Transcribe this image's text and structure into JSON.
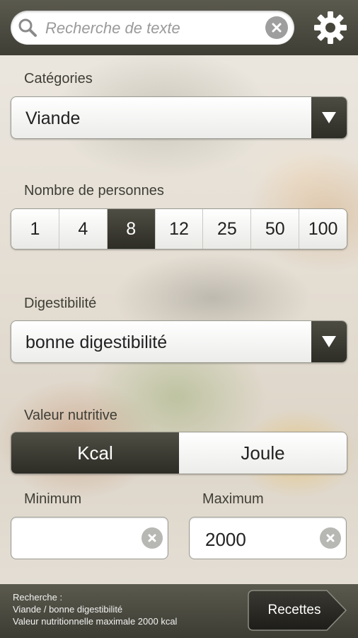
{
  "search": {
    "placeholder": "Recherche de texte"
  },
  "categories": {
    "label": "Catégories",
    "selected": "Viande"
  },
  "persons": {
    "label": "Nombre de personnes",
    "options": [
      "1",
      "4",
      "8",
      "12",
      "25",
      "50",
      "100"
    ],
    "selected": "8"
  },
  "digestibility": {
    "label": "Digestibilité",
    "selected": "bonne digestibilité"
  },
  "nutrition": {
    "label": "Valeur nutritive",
    "units": [
      "Kcal",
      "Joule"
    ],
    "selected_unit": "Kcal",
    "min_label": "Minimum",
    "min_value": "",
    "max_label": "Maximum",
    "max_value": "2000"
  },
  "footer": {
    "summary_lines": [
      "Recherche :",
      "Viande / bonne digestibilité",
      "Valeur nutritionnelle maximale 2000 kcal"
    ],
    "button_label": "Recettes"
  },
  "icons": {
    "search": "search-icon",
    "clear": "clear-icon",
    "settings": "gear-icon",
    "dropdown": "dropdown-arrow-icon"
  },
  "colors": {
    "bar_dark": "#3f3e35",
    "active_segment": "#2d2c25",
    "clear_icon": "#9e9e9e"
  }
}
